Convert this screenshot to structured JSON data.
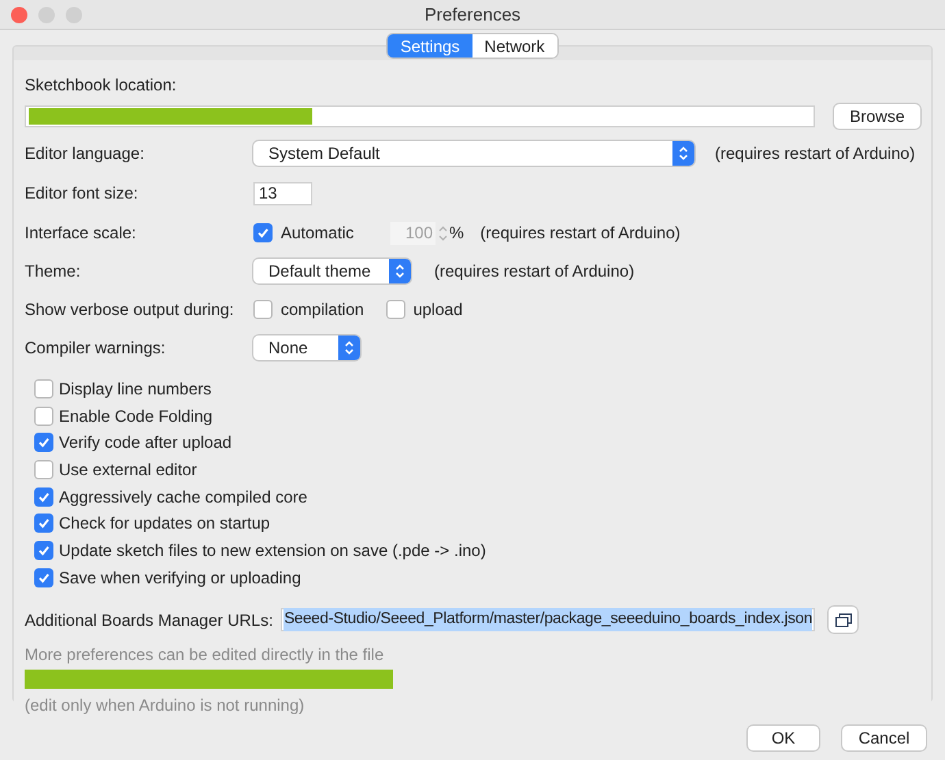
{
  "window": {
    "title": "Preferences"
  },
  "tabs": [
    {
      "label": "Settings",
      "selected": true
    },
    {
      "label": "Network",
      "selected": false
    }
  ],
  "sketchbook": {
    "label": "Sketchbook location:",
    "browse": "Browse"
  },
  "editor_language": {
    "label": "Editor language:",
    "value": "System Default",
    "note": "(requires restart of Arduino)"
  },
  "editor_font_size": {
    "label": "Editor font size:",
    "value": "13"
  },
  "interface_scale": {
    "label": "Interface scale:",
    "automatic": {
      "label": "Automatic",
      "checked": true
    },
    "value": "100",
    "unit": "%",
    "note": "(requires restart of Arduino)"
  },
  "theme": {
    "label": "Theme:",
    "value": "Default theme",
    "note": "(requires restart of Arduino)"
  },
  "verbose": {
    "label": "Show verbose output during:",
    "options": [
      {
        "label": "compilation",
        "checked": false
      },
      {
        "label": "upload",
        "checked": false
      }
    ]
  },
  "compiler_warnings": {
    "label": "Compiler warnings:",
    "value": "None"
  },
  "options": [
    {
      "label": "Display line numbers",
      "checked": false
    },
    {
      "label": "Enable Code Folding",
      "checked": false
    },
    {
      "label": "Verify code after upload",
      "checked": true
    },
    {
      "label": "Use external editor",
      "checked": false
    },
    {
      "label": "Aggressively cache compiled core",
      "checked": true
    },
    {
      "label": "Check for updates on startup",
      "checked": true
    },
    {
      "label": "Update sketch files to new extension on save (.pde -> .ino)",
      "checked": true
    },
    {
      "label": "Save when verifying or uploading",
      "checked": true
    }
  ],
  "boards_urls": {
    "label": "Additional Boards Manager URLs:",
    "value": "Seeed-Studio/Seeed_Platform/master/package_seeeduino_boards_index.json"
  },
  "file_note": "More preferences can be edited directly in the file",
  "edit_note": "(edit only when Arduino is not running)",
  "buttons": [
    "OK",
    "Cancel"
  ]
}
